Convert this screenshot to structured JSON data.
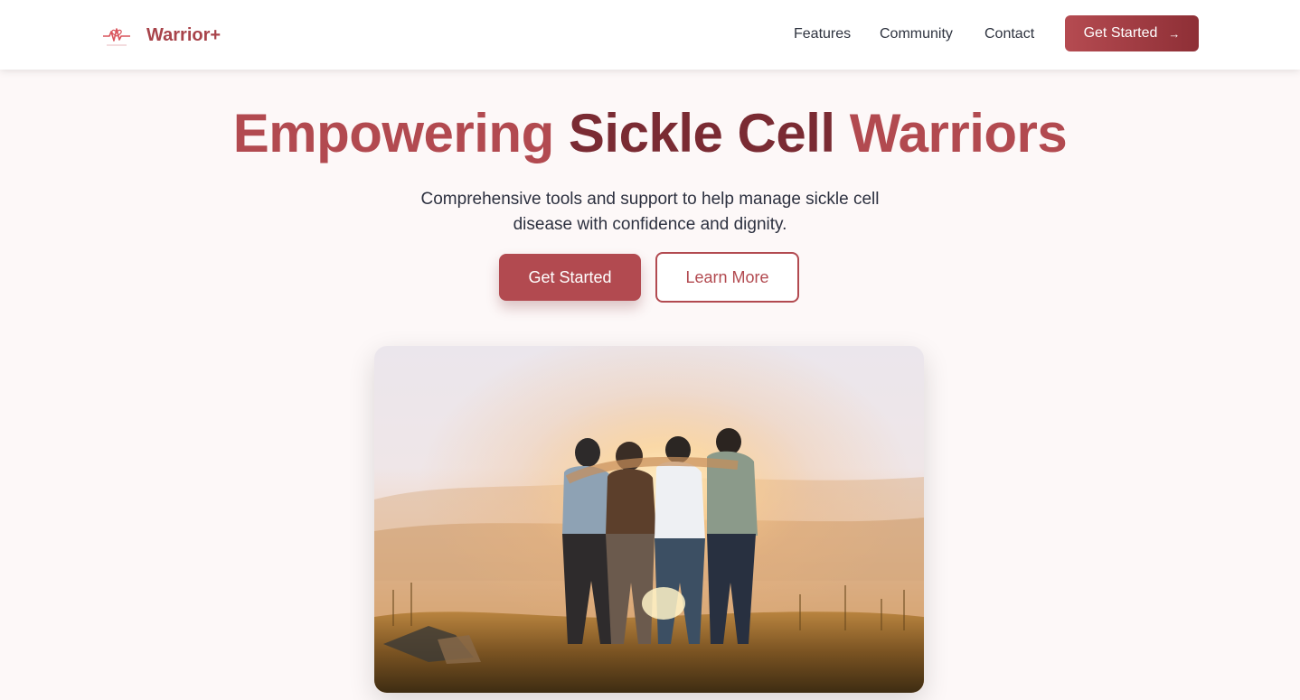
{
  "nav": {
    "brand": "Warrior+",
    "links": [
      "Features",
      "Community",
      "Contact"
    ],
    "cta": "Get Started",
    "cta_icon": "arrow-right-icon",
    "logo_icon": "heartbeat-logo-icon"
  },
  "hero": {
    "title_part1": "Empowering",
    "title_part2": "Sickle Cell",
    "title_part3": "Warriors",
    "subtitle": "Comprehensive tools and support to help manage sickle cell disease with confidence and dignity.",
    "primary_button": "Get Started",
    "secondary_button": "Learn More",
    "image": "group-of-friends-at-sunset-photo"
  },
  "colors": {
    "brand": "#b24a50",
    "brand_dark": "#7a2b33",
    "text": "#2d3140",
    "background": "#fdf8f8"
  }
}
